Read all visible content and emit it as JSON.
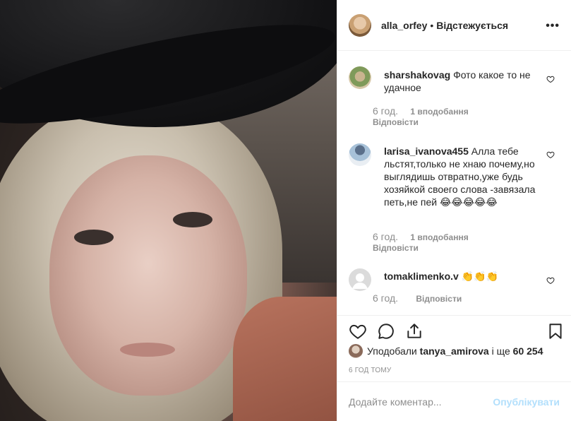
{
  "post": {
    "username": "alla_orfey",
    "separator": "•",
    "follow_status": "Відстежується",
    "more": "•••"
  },
  "comments": [
    {
      "username": "sharshakovag",
      "text": "Фото какое то не удачное",
      "time": "6 год.",
      "likes": "1 вподобання",
      "reply": "Відповісти"
    },
    {
      "username": "larisa_ivanova455",
      "text": "Алла тебе льстят,только не хнаю почему,но выглядишь отвратно,уже будь хозяйкой своего слова -завязала петь,не пей 😂😂😂😂😂",
      "time": "6 год.",
      "likes": "1 вподобання",
      "reply": "Відповісти"
    },
    {
      "username": "tomaklimenko.v",
      "text": "👏👏👏",
      "time": "6 год.",
      "reply": "Відповісти"
    }
  ],
  "likes": {
    "prefix": "Уподобали",
    "user": "tanya_amirova",
    "middle": "і ще",
    "count": "60 254"
  },
  "timestamp": "6 ГОД ТОМУ",
  "add_comment": {
    "placeholder": "Додайте коментар...",
    "post_label": "Опублікувати"
  },
  "colors": {
    "text": "#262626",
    "muted": "#8e8e8e",
    "border": "#efefef",
    "post_disabled": "#b2dffc"
  },
  "icons": [
    "more-icon",
    "heart-icon",
    "comment-icon",
    "share-icon",
    "bookmark-icon"
  ]
}
